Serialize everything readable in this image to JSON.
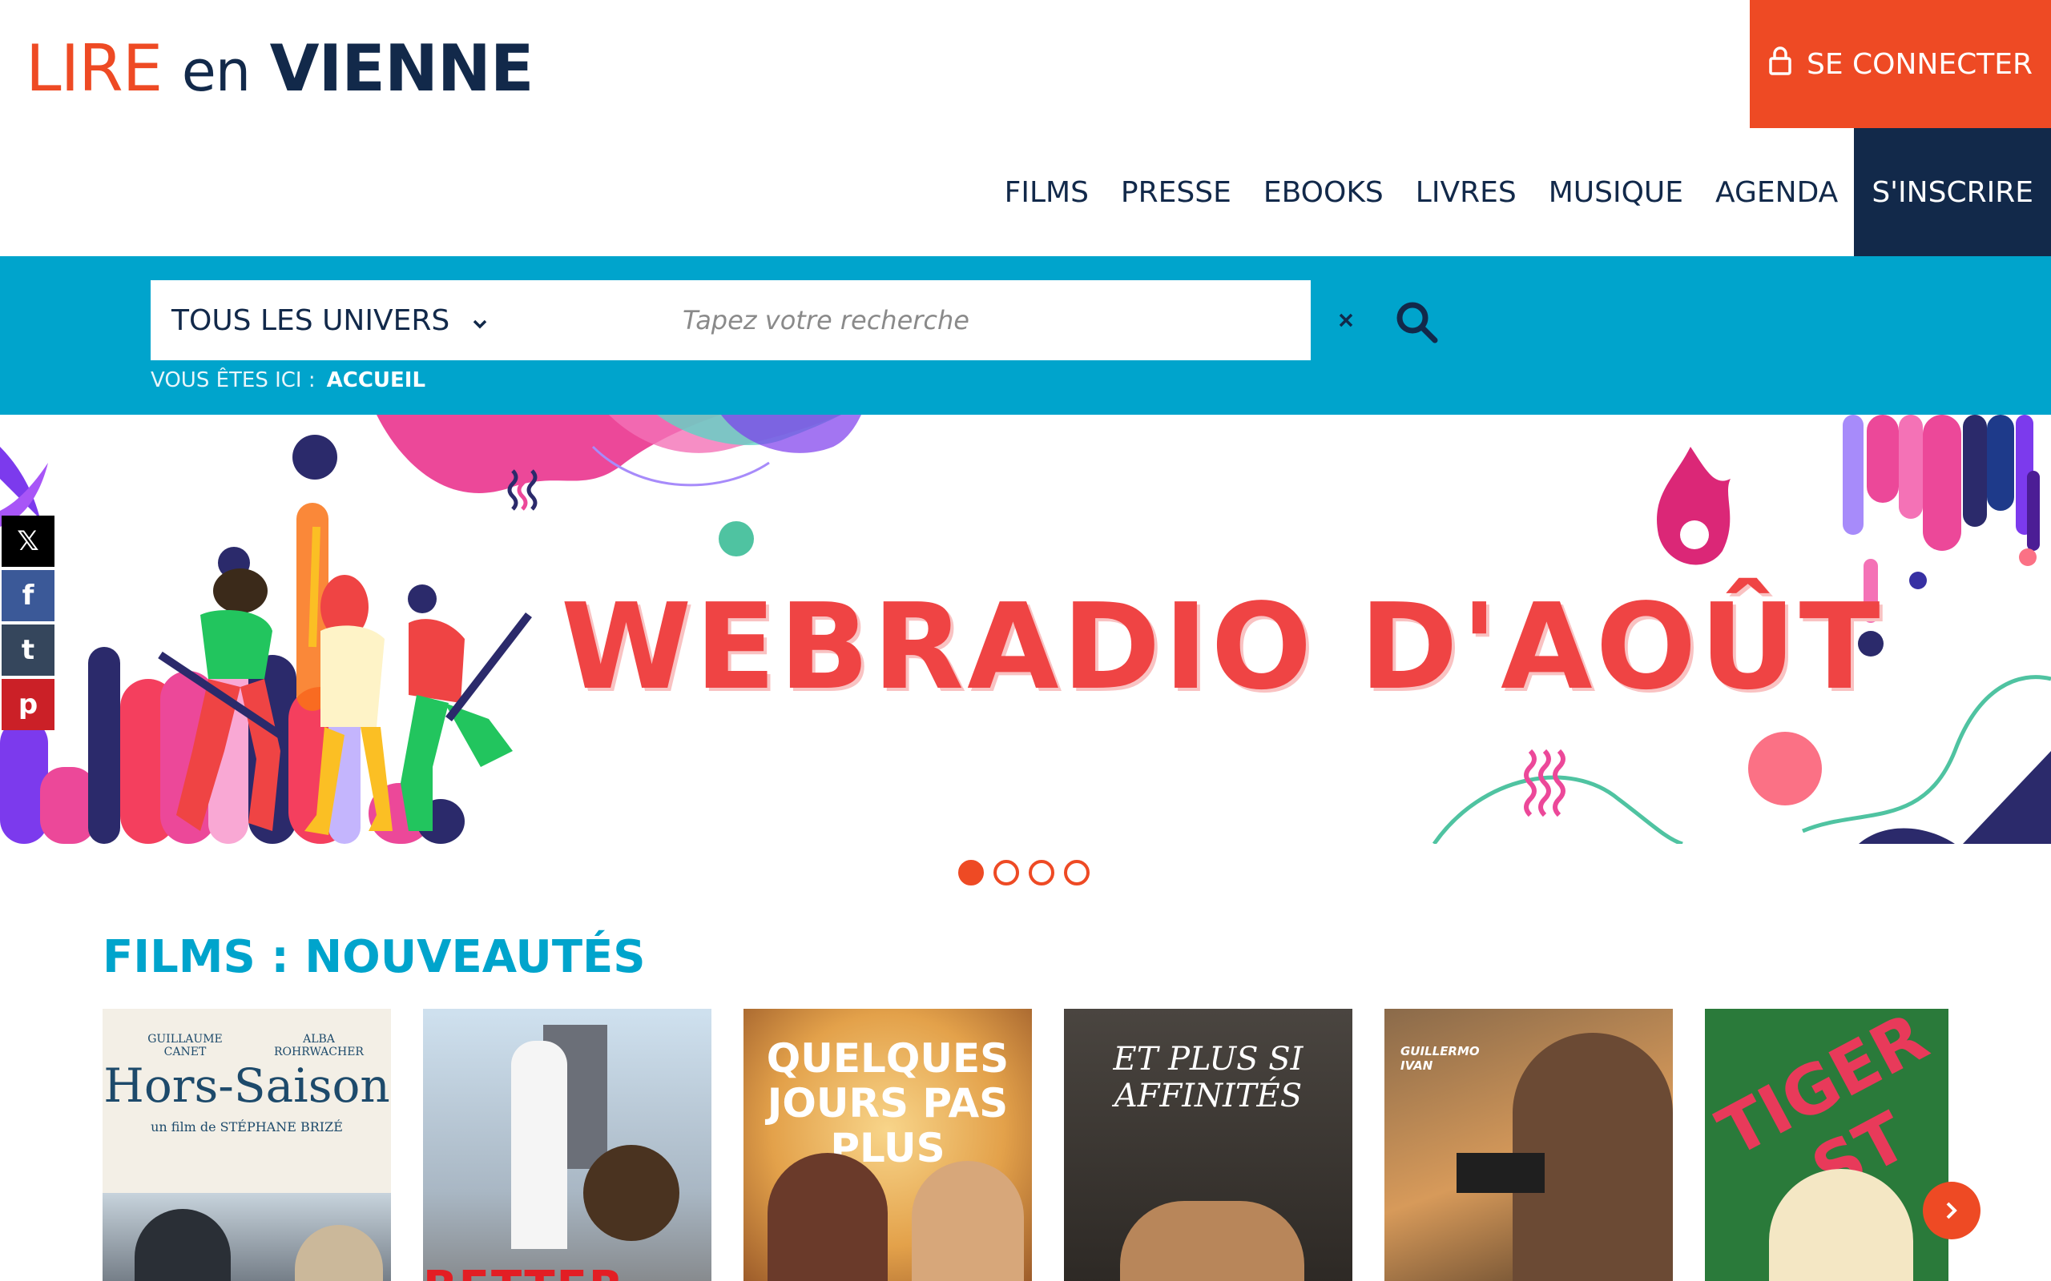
{
  "header": {
    "logo": {
      "lire": "LIRE",
      "en": "en",
      "vienne": "VIENNE"
    },
    "login_label": "SE CONNECTER",
    "nav": [
      "FILMS",
      "PRESSE",
      "EBOOKS",
      "LIVRES",
      "MUSIQUE",
      "AGENDA"
    ],
    "signup_label": "S'INSCRIRE"
  },
  "search": {
    "universe_selected": "TOUS LES UNIVERS",
    "placeholder": "Tapez votre recherche",
    "clear_symbol": "×"
  },
  "breadcrumb": {
    "prefix": "VOUS ÊTES ICI :",
    "current": "ACCUEIL"
  },
  "banner": {
    "title": "WEBRADIO D'AOÛT",
    "slide_count": 4,
    "active_slide": 1
  },
  "social": [
    {
      "name": "x",
      "glyph": "𝕏"
    },
    {
      "name": "facebook",
      "glyph": "f"
    },
    {
      "name": "tumblr",
      "glyph": "t"
    },
    {
      "name": "pinterest",
      "glyph": "p"
    }
  ],
  "films": {
    "title": "FILMS : NOUVEAUTÉS",
    "posters": [
      {
        "title": "Hors-Saison",
        "top_left": "GUILLAUME CANET",
        "top_right": "ALBA ROHRWACHER",
        "credit": "un film de STÉPHANE BRIZÉ",
        "bg": "#f3efe6",
        "color": "#1d4a6b"
      },
      {
        "title": "",
        "bg": "#bcd3e6",
        "color": "#e31e24",
        "bottom": "BETTER"
      },
      {
        "title": "QUELQUES JOURS PAS PLUS",
        "bg": "#e3a14a",
        "color": "#ffffff"
      },
      {
        "title": "ET PLUS SI AFFINITÉS",
        "bg": "#3a3632",
        "color": "#ffffff"
      },
      {
        "title": "",
        "top_left": "GUILLERMO IVAN",
        "bg": "#8a6a4a",
        "color": "#ffffff"
      },
      {
        "title": "TIGER ST",
        "bg": "#2a7a3a",
        "color": "#e83a5a"
      }
    ]
  },
  "colors": {
    "brand_orange": "#ee4a24",
    "navy": "#12294a",
    "cyan": "#00a4cc"
  }
}
